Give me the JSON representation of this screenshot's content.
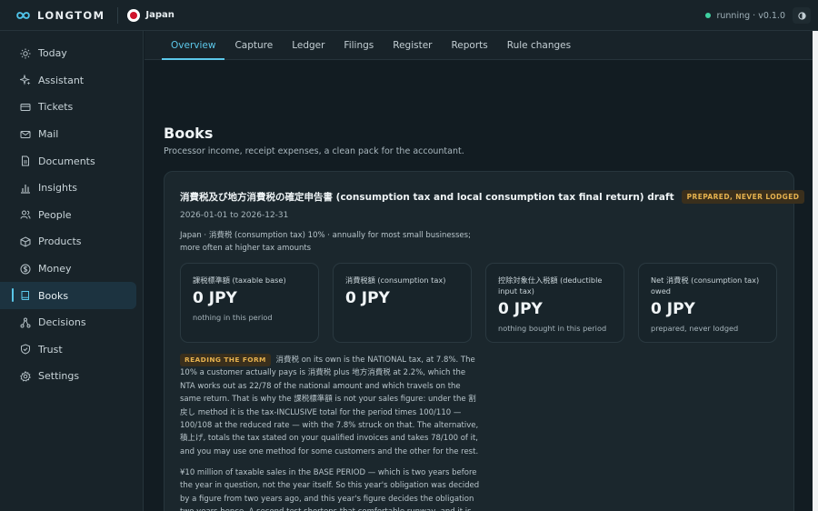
{
  "app": {
    "name": "LONGTOM",
    "country": "Japan",
    "status": "running · v0.1.0"
  },
  "sidebar": {
    "items": [
      {
        "label": "Today",
        "icon": "sun-icon"
      },
      {
        "label": "Assistant",
        "icon": "sparkle-icon"
      },
      {
        "label": "Tickets",
        "icon": "ticket-icon"
      },
      {
        "label": "Mail",
        "icon": "mail-icon"
      },
      {
        "label": "Documents",
        "icon": "document-icon"
      },
      {
        "label": "Insights",
        "icon": "bar-chart-icon"
      },
      {
        "label": "People",
        "icon": "people-icon"
      },
      {
        "label": "Products",
        "icon": "box-icon"
      },
      {
        "label": "Money",
        "icon": "coin-icon"
      },
      {
        "label": "Books",
        "icon": "book-icon"
      },
      {
        "label": "Decisions",
        "icon": "branch-icon"
      },
      {
        "label": "Trust",
        "icon": "shield-icon"
      },
      {
        "label": "Settings",
        "icon": "gear-icon"
      }
    ],
    "active": "Books"
  },
  "tabs": [
    "Overview",
    "Capture",
    "Ledger",
    "Filings",
    "Register",
    "Reports",
    "Rule changes"
  ],
  "active_tab": "Overview",
  "page": {
    "title": "Books",
    "subtitle": "Processor income, receipt expenses, a clean pack for the accountant."
  },
  "card": {
    "title": "消費税及び地方消費税の確定申告書 (consumption tax and local consumption tax final return) draft",
    "badge": "PREPARED, NEVER LODGED",
    "dates": "2026-01-01 to 2026-12-31",
    "desc": "Japan · 消費税 (consumption tax) 10% · annually for most small businesses; more often at higher tax amounts",
    "stats": [
      {
        "label": "課税標準額 (taxable base)",
        "value": "0 JPY",
        "note": "nothing in this period"
      },
      {
        "label": "消費税額 (consumption tax)",
        "value": "0 JPY",
        "note": ""
      },
      {
        "label": "控除対象仕入税額 (deductible input tax)",
        "value": "0 JPY",
        "note": "nothing bought in this period"
      },
      {
        "label": "Net 消費税 (consumption tax) owed",
        "value": "0 JPY",
        "note": "prepared, never lodged"
      }
    ],
    "reading_tag": "READING THE FORM",
    "reading_text": "消費税 on its own is the NATIONAL tax, at 7.8%. The 10% a customer actually pays is 消費税 plus 地方消費税 at 2.2%, which the NTA works out as 22/78 of the national amount and which travels on the same return. That is why the 課税標準額 is not your sales figure: under the 割戻し method it is the tax-INCLUSIVE total for the period times 100/110 — 100/108 at the reduced rate — with the 7.8% struck on that. The alternative, 積上げ, totals the tax stated on your qualified invoices and takes 78/100 of it, and you may use one method for some customers and the other for the rest.",
    "para2": "¥10 million of taxable sales in the BASE PERIOD — which is two years before the year in question, not the year itself. So this year's obligation was decided by a figure from two years ago, and this year's figure decides the obligation two years hence. A second test shortens that comfortable runway, and it is the one a growing"
  }
}
